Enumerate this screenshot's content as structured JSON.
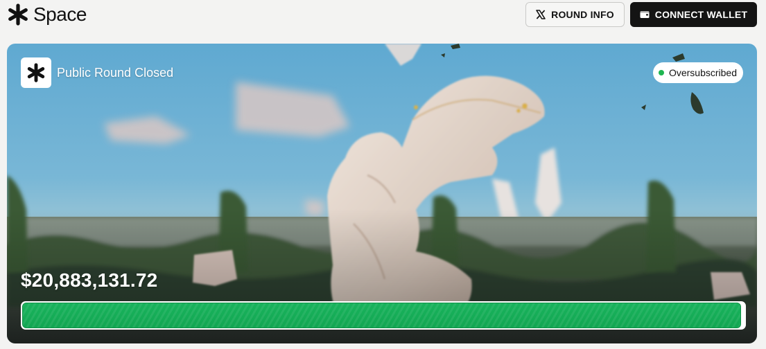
{
  "header": {
    "brand_name": "Space",
    "brand_icon": "asterisk-logo-icon",
    "round_info_label": "ROUND INFO",
    "round_info_icon": "x-logo-icon",
    "connect_wallet_label": "CONNECT WALLET",
    "connect_wallet_icon": "wallet-icon"
  },
  "hero": {
    "round_title": "Public Round Closed",
    "status_label": "Oversubscribed",
    "status_color": "#1fb550",
    "amount_raised": "$20,883,131.72",
    "progress_fraction": 0.995,
    "progress_color": "#13a955"
  }
}
